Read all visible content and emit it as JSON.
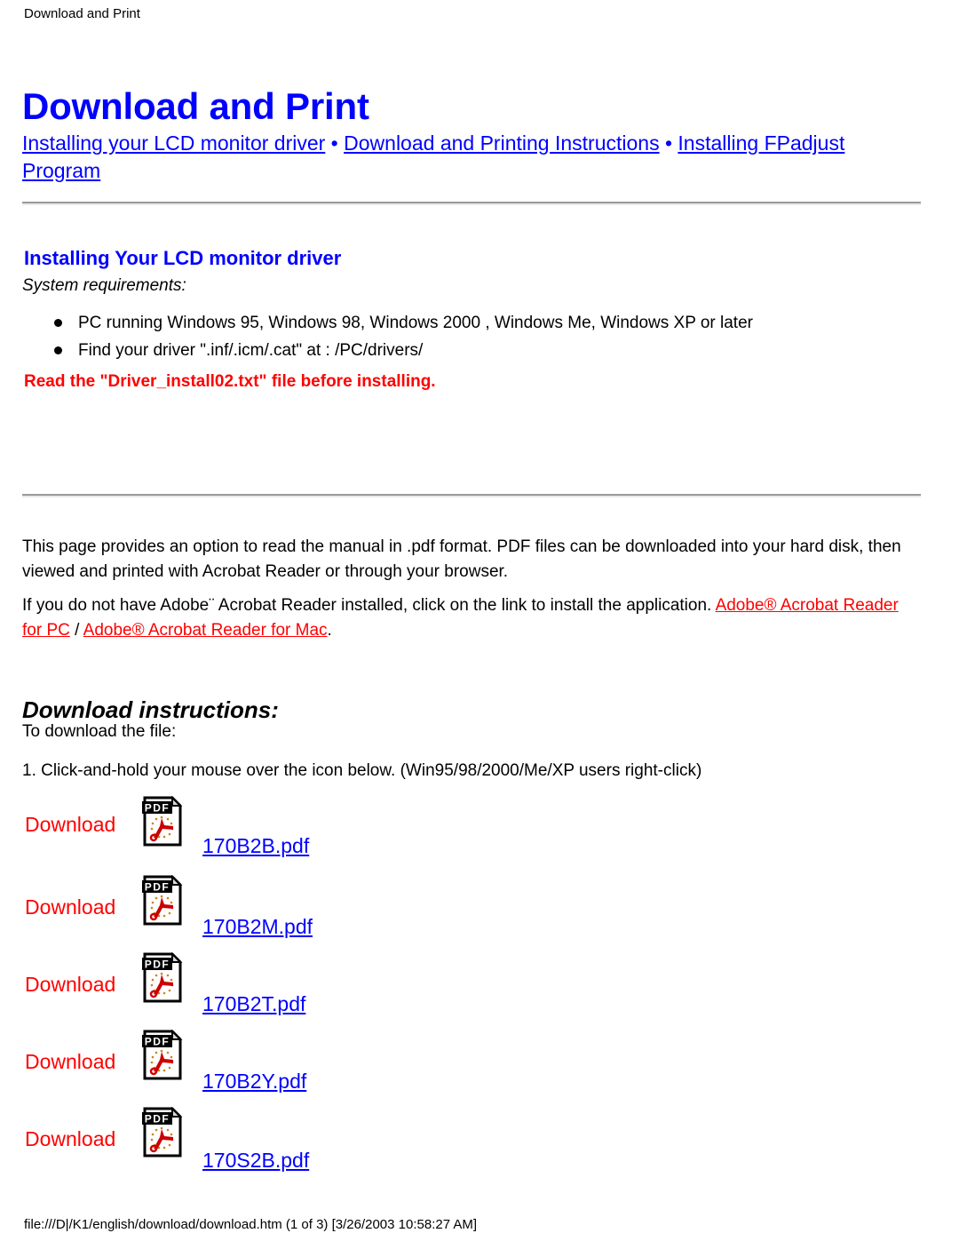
{
  "running_head": "Download and Print",
  "page_title": "Download and Print",
  "nav": {
    "separator": " • ",
    "links": [
      "Installing your LCD monitor driver",
      "Download and Printing Instructions",
      "Installing FPadjust Program"
    ]
  },
  "driver_section": {
    "heading": "Installing Your LCD monitor driver",
    "sysreq_label": "System requirements:",
    "requirements": [
      "PC running Windows 95, Windows 98, Windows 2000 , Windows Me, Windows XP or later",
      "Find your driver \".inf/.icm/.cat\" at : /PC/drivers/"
    ],
    "warning": "Read the \"Driver_install02.txt\" file before installing."
  },
  "intro": {
    "paragraph_1": "This page provides an option to read the manual in .pdf format. PDF files can be downloaded into your hard disk, then viewed and printed with Acrobat Reader or through your browser.",
    "paragraph_2_part_1": "If you do not have Adobe",
    "paragraph_2_tm": "¨",
    "paragraph_2_part_2": " Acrobat Reader installed, click on the link to install the application. ",
    "adobe_pc_link": "Adobe® Acrobat Reader for PC",
    "paragraph_2_slash": " / ",
    "adobe_mac_link": "Adobe® Acrobat Reader for Mac",
    "paragraph_2_end": "."
  },
  "download": {
    "heading": "Download instructions:",
    "line_1": "To download the file:",
    "line_2": "1. Click-and-hold your mouse over the icon below. (Win95/98/2000/Me/XP users right-click)",
    "download_label": "Download",
    "icon_label": "PDF",
    "files": [
      {
        "label": "Download",
        "filename": "170B2B.pdf"
      },
      {
        "label": "Download",
        "filename": "170B2M.pdf"
      },
      {
        "label": "Download",
        "filename": "170B2T.pdf"
      },
      {
        "label": "Download",
        "filename": "170B2Y.pdf"
      },
      {
        "label": "Download",
        "filename": "170S2B.pdf"
      }
    ]
  },
  "footer": "file:///D|/K1/english/download/download.htm (1 of 3) [3/26/2003 10:58:27 AM]",
  "colors": {
    "link_blue": "#0000ff",
    "alert_red": "#ff0000",
    "text_black": "#000000",
    "rule_shadow": "#9a9a9a",
    "rule_highlight": "#e9e9e9"
  }
}
